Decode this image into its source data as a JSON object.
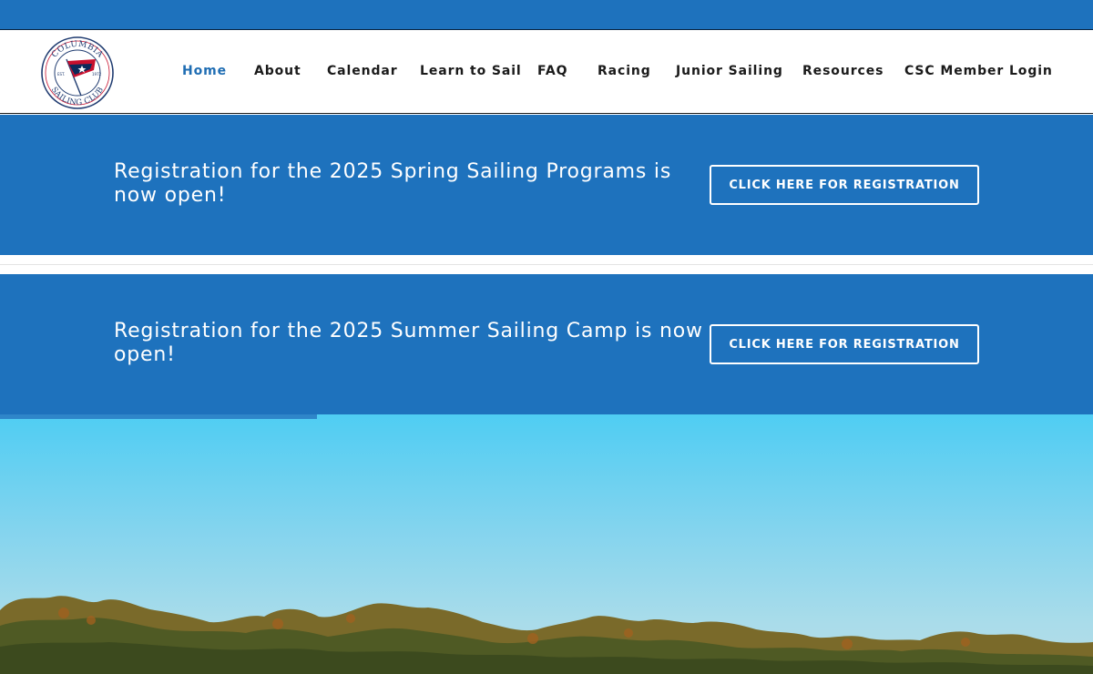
{
  "brand": {
    "logo_top_text": "COLUMBIA",
    "logo_bottom_text": "SAILING CLUB",
    "logo_est": "EST.",
    "logo_year": "1972",
    "primary_color": "#1e72bd",
    "flag_colors": [
      "#c8102e",
      "#0b2a5b",
      "#ffffff"
    ]
  },
  "nav": {
    "items": [
      {
        "label": "Home",
        "active": true
      },
      {
        "label": "About",
        "active": false
      },
      {
        "label": "Calendar",
        "active": false
      },
      {
        "label": "Learn to Sail",
        "active": false
      },
      {
        "label": "FAQ",
        "active": false
      },
      {
        "label": "Racing",
        "active": false
      },
      {
        "label": "Junior Sailing",
        "active": false
      },
      {
        "label": "Resources",
        "active": false
      },
      {
        "label": "CSC Member Login",
        "active": false
      }
    ]
  },
  "banners": [
    {
      "text": "Registration for the 2025 Spring Sailing Programs is now open!",
      "button_label": "CLICK HERE FOR REGISTRATION"
    },
    {
      "text": "Registration for the 2025 Summer Sailing Camp is now open!",
      "button_label": "CLICK HERE FOR REGISTRATION"
    }
  ],
  "hero": {
    "slider_progress": 0.29,
    "icon": "lake-treeline-photo"
  }
}
